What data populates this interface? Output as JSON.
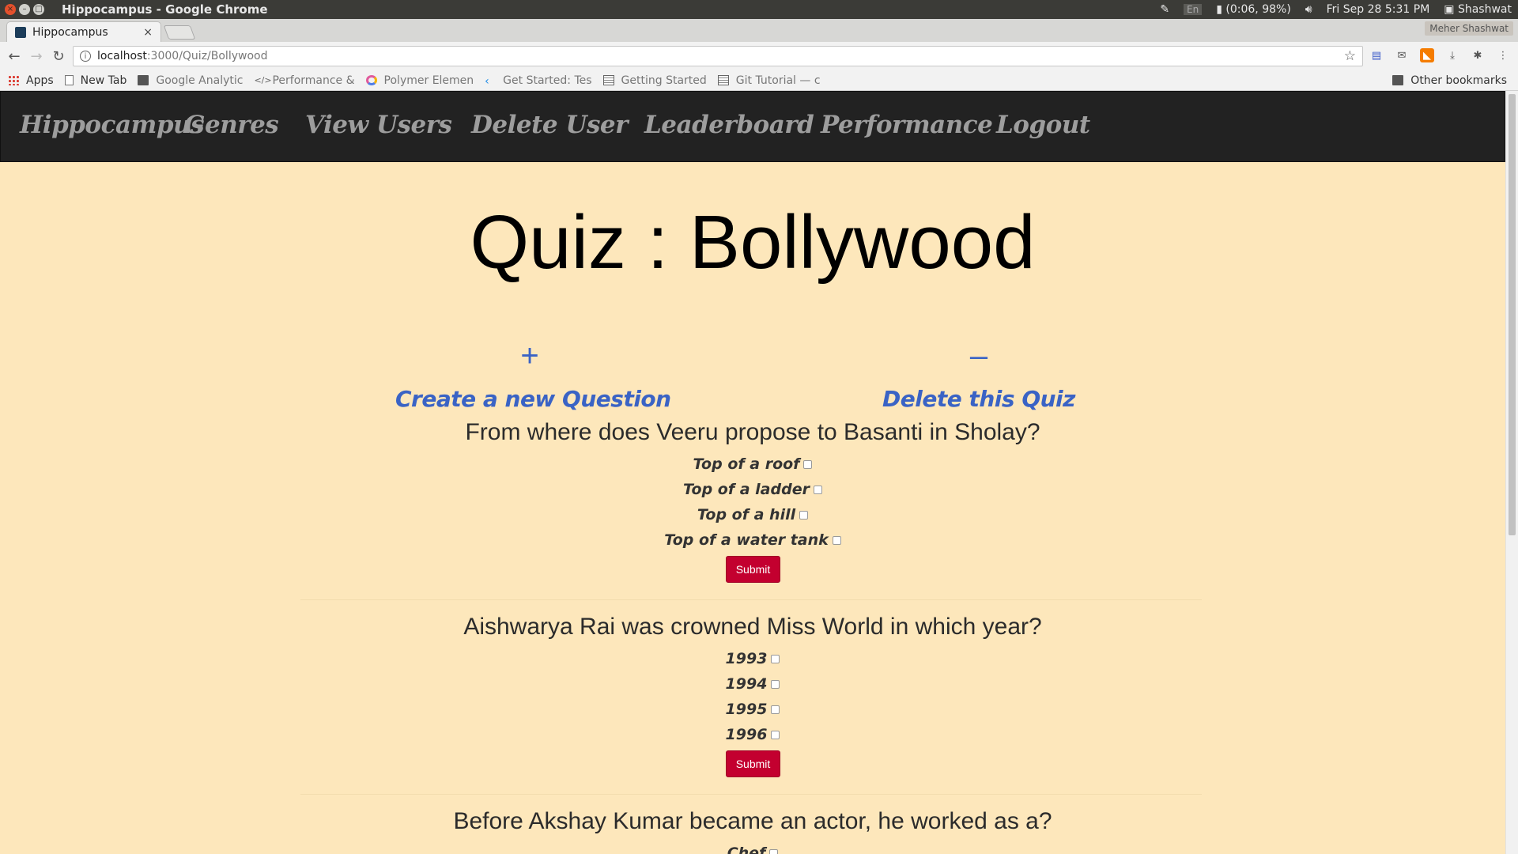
{
  "os": {
    "window_title": "Hippocampus - Google Chrome",
    "keyboard": "En",
    "battery": "(0:06, 98%)",
    "datetime": "Fri Sep 28  5:31 PM",
    "user": "Shashwat"
  },
  "browser": {
    "tab_title": "Hippocampus",
    "profile": "Meher Shashwat",
    "url_host": "localhost",
    "url_path": ":3000/Quiz/Bollywood",
    "bookmarks": [
      {
        "label": "Apps",
        "icon": "apps-grid-icon"
      },
      {
        "label": "New Tab",
        "icon": "page-icon"
      },
      {
        "label": "Google Analytic",
        "icon": "folder-icon"
      },
      {
        "label": "Performance & ",
        "icon": "code-icon"
      },
      {
        "label": "Polymer Elemen",
        "icon": "polymer-icon"
      },
      {
        "label": "Get Started: Tes",
        "icon": "flutter-icon"
      },
      {
        "label": "Getting Started",
        "icon": "doc-icon"
      },
      {
        "label": "Git Tutorial — c",
        "icon": "doc-icon"
      }
    ],
    "other_bookmarks": "Other bookmarks"
  },
  "nav": {
    "brand": "Hippocampus",
    "items": [
      "Genres",
      "View Users",
      "Delete User",
      "Leaderboard",
      "Performance",
      "Logout"
    ]
  },
  "page": {
    "title": "Quiz : Bollywood",
    "create": {
      "glyph": "+",
      "label": "Create a new Question"
    },
    "delete": {
      "glyph": "–",
      "label": "Delete this Quiz"
    },
    "submit_label": "Submit",
    "accent_color": "#3a63c5",
    "submit_color": "#c3002f"
  },
  "questions": [
    {
      "text": "From where does Veeru propose to Basanti in Sholay?",
      "options": [
        "Top of a roof",
        "Top of a ladder",
        "Top of a hill",
        "Top of a water tank"
      ]
    },
    {
      "text": "Aishwarya Rai was crowned Miss World in which year?",
      "options": [
        "1993",
        "1994",
        "1995",
        "1996"
      ]
    },
    {
      "text": "Before Akshay Kumar became an actor, he worked as a?",
      "options": [
        "Chef"
      ]
    }
  ]
}
